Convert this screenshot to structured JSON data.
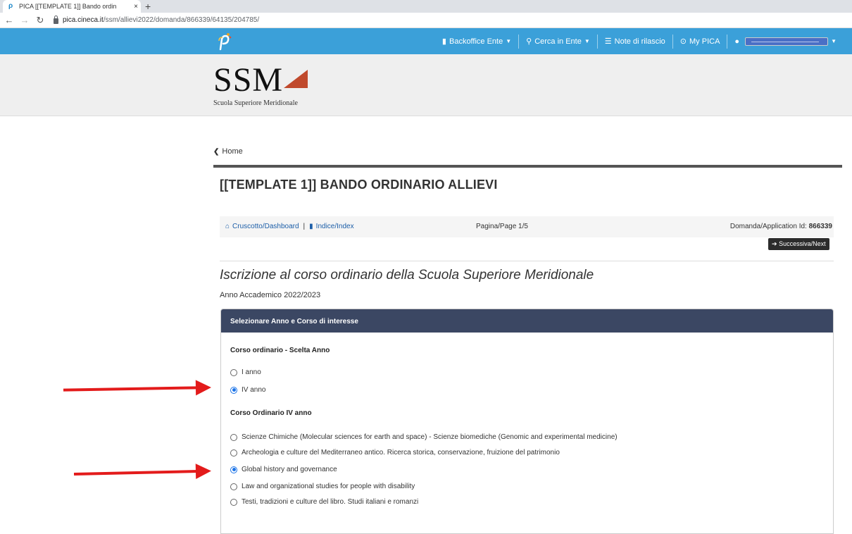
{
  "browser": {
    "tab_title": "PICA [[TEMPLATE 1]] Bando ordin",
    "tab_close": "×",
    "new_tab": "+",
    "url_host": "pica.cineca.it",
    "url_path": "/ssm/allievi2022/domanda/866339/64135/204785/"
  },
  "navbar": {
    "backoffice": "Backoffice Ente",
    "cerca": "Cerca in Ente",
    "note": "Note di rilascio",
    "mypica": "My PICA"
  },
  "brand": {
    "name": "SSM",
    "subtitle": "Scuola Superiore Meridionale"
  },
  "breadcrumb": {
    "home": "Home"
  },
  "page": {
    "title": "[[TEMPLATE 1]] BANDO ORDINARIO ALLIEVI",
    "subtitle": "Iscrizione al corso ordinario della Scuola Superiore Meridionale",
    "year": "Anno Accademico 2022/2023"
  },
  "toolbar": {
    "dashboard": "Cruscotto/Dashboard",
    "separator": "|",
    "index": "Indice/Index",
    "page_label": "Pagina/Page 1/5",
    "app_id_label": "Domanda/Application Id:",
    "app_id_value": "866339",
    "next": "Successiva/Next"
  },
  "panel": {
    "header": "Selezionare Anno e Corso di interesse",
    "year_section": "Corso ordinario - Scelta Anno",
    "year_options": [
      {
        "label": "I anno",
        "checked": false
      },
      {
        "label": "IV anno",
        "checked": true
      }
    ],
    "course_section": "Corso Ordinario IV anno",
    "course_options": [
      {
        "label": "Scienze Chimiche (Molecular sciences for earth and space) - Scienze biomediche (Genomic and experimental medicine)",
        "checked": false
      },
      {
        "label": "Archeologia e culture del Mediterraneo antico. Ricerca storica, conservazione, fruizione del patrimonio",
        "checked": false
      },
      {
        "label": "Global history and governance",
        "checked": true
      },
      {
        "label": "Law and organizational studies for people with disability",
        "checked": false
      },
      {
        "label": "Testi, tradizioni e culture del libro. Studi italiani e romanzi",
        "checked": false
      }
    ]
  },
  "colors": {
    "navbar": "#3ba0d9",
    "panel_header": "#3b4763",
    "annotation_arrow": "#e31b1b",
    "logo_triangle": "#c0492c"
  }
}
